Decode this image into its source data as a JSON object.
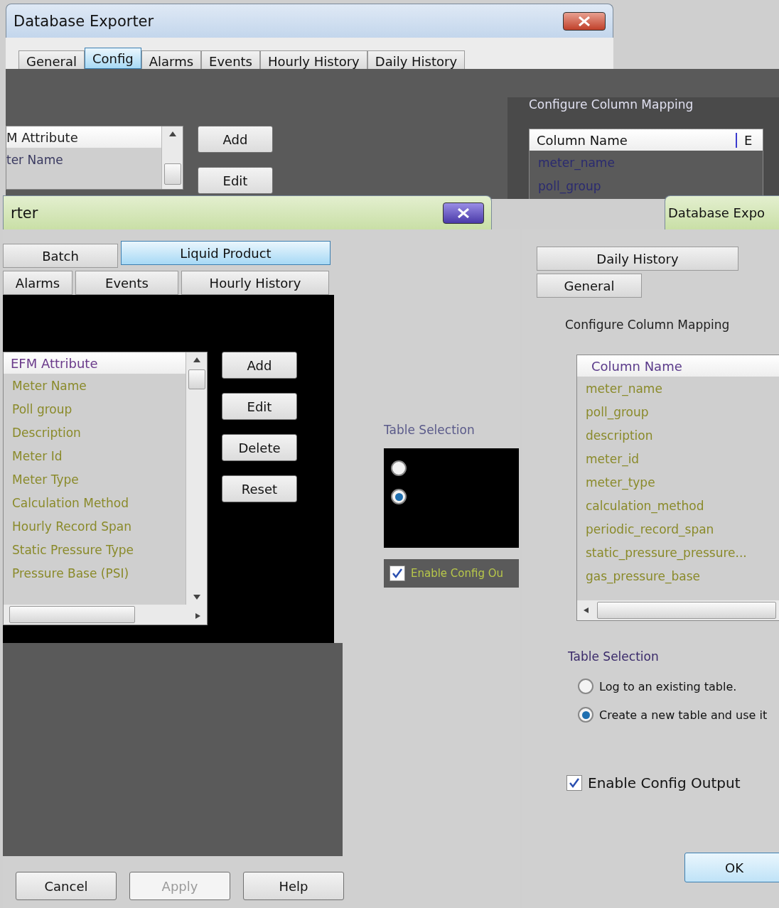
{
  "back_window": {
    "title": "Database Exporter",
    "tabs": [
      {
        "label": "General",
        "selected": false
      },
      {
        "label": "Config",
        "selected": true
      },
      {
        "label": "Alarms",
        "selected": false
      },
      {
        "label": "Events",
        "selected": false
      },
      {
        "label": "Hourly History",
        "selected": false
      },
      {
        "label": "Daily History",
        "selected": false
      }
    ],
    "attribute_list": {
      "header": "M Attribute",
      "rows": [
        "ter Name"
      ]
    },
    "buttons": [
      "Add",
      "Edit"
    ],
    "mapping": {
      "title": "Configure Column Mapping",
      "columns": [
        "Column Name",
        "E"
      ],
      "rows": [
        "meter_name",
        "poll_group"
      ]
    }
  },
  "middle_window": {
    "title": "rter",
    "tabs_row_1": [
      {
        "label": "Batch",
        "selected": false
      },
      {
        "label": "Liquid Product",
        "selected": true
      }
    ],
    "tabs_row_2": [
      {
        "label": "Alarms",
        "selected": false
      },
      {
        "label": "Events",
        "selected": false
      },
      {
        "label": "Hourly History",
        "selected": false
      }
    ],
    "attribute_list": {
      "header": "EFM Attribute",
      "rows": [
        "Meter Name",
        "Poll group",
        "Description",
        "Meter Id",
        "Meter Type",
        "Calculation Method",
        "Hourly Record Span",
        "Static Pressure Type",
        "Pressure Base (PSI)"
      ]
    },
    "buttons": [
      "Add",
      "Edit",
      "Delete",
      "Reset"
    ],
    "side_panel": {
      "table_selection": "Table Selection",
      "options": [
        {
          "selected": false
        },
        {
          "selected": true
        }
      ],
      "enable_config": {
        "label": "Enable Config Ou",
        "checked": true
      }
    },
    "footer_buttons": [
      {
        "label": "Cancel",
        "disabled": false
      },
      {
        "label": "Apply",
        "disabled": true
      },
      {
        "label": "Help",
        "disabled": false
      }
    ]
  },
  "front_window": {
    "title": "Database Expo",
    "tabs": [
      {
        "label": "Daily History",
        "selected": false
      },
      {
        "label": "General",
        "selected": false
      }
    ],
    "mapping": {
      "title": "Configure Column Mapping",
      "columns": [
        "Column Name"
      ],
      "rows": [
        "meter_name",
        "poll_group",
        "description",
        "meter_id",
        "meter_type",
        "calculation_method",
        "periodic_record_span",
        "static_pressure_pressure...",
        "gas_pressure_base"
      ]
    },
    "table_selection": {
      "title": "Table Selection",
      "options": [
        {
          "label": "Log to an existing table.",
          "selected": false
        },
        {
          "label": "Create a new table and use it",
          "selected": true
        }
      ]
    },
    "enable_config": {
      "label": "Enable Config Output",
      "checked": true
    },
    "ok_button": "OK"
  }
}
